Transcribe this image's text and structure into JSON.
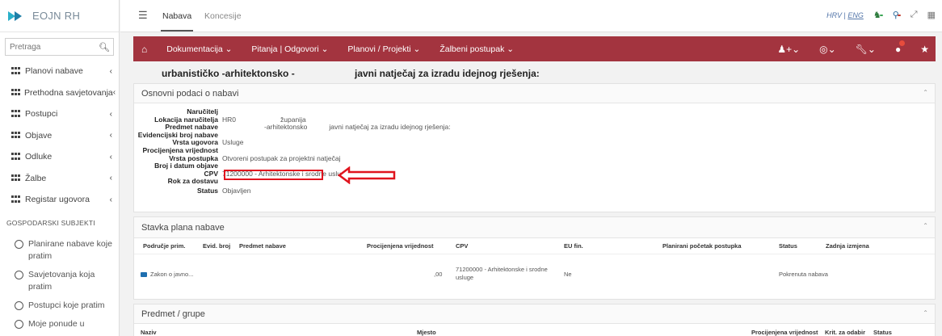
{
  "app": {
    "logo_text": "EOJN RH"
  },
  "search": {
    "placeholder": "Pretraga"
  },
  "sidebar": {
    "items": [
      {
        "label": "Planovi nabave"
      },
      {
        "label": "Prethodna savjetovanja"
      },
      {
        "label": "Postupci"
      },
      {
        "label": "Objave"
      },
      {
        "label": "Odluke"
      },
      {
        "label": "Žalbe"
      },
      {
        "label": "Registar ugovora"
      }
    ],
    "section_label": "GOSPODARSKI SUBJEKTI",
    "follow_items": [
      {
        "label": "Planirane nabave koje pratim"
      },
      {
        "label": "Savjetovanja koja pratim"
      },
      {
        "label": "Postupci koje pratim"
      },
      {
        "label": "Moje ponude u"
      }
    ]
  },
  "topbar": {
    "tabs": [
      {
        "label": "Nabava"
      },
      {
        "label": "Koncesije"
      }
    ],
    "lang_hr": "HRV",
    "lang_sep": "|",
    "lang_en": "ENG"
  },
  "menubar": {
    "items": [
      {
        "label": "Dokumentacija ⌄"
      },
      {
        "label": "Pitanja | Odgovori ⌄"
      },
      {
        "label": "Planovi / Projekti ⌄"
      },
      {
        "label": "Žalbeni postupak ⌄"
      }
    ]
  },
  "title": {
    "part1": "urbanističko -arhitektonsko -",
    "part2": "javni natječaj za izradu idejnog rješenja:"
  },
  "osnovni": {
    "heading": "Osnovni podaci o nabavi",
    "rows": [
      {
        "label": "Naručitelj",
        "value": ""
      },
      {
        "label": "Lokacija naručitelja",
        "value": "HR0",
        "extra": "županija"
      },
      {
        "label": "Predmet nabave",
        "value": "-arhitektonsko",
        "extra": "javni natječaj za izradu idejnog rješenja:"
      },
      {
        "label": "Evidencijski broj nabave",
        "value": ""
      },
      {
        "label": "Vrsta ugovora",
        "value": "Usluge"
      },
      {
        "label": "Procijenjena vrijednost",
        "value": ""
      },
      {
        "label": "Vrsta postupka",
        "value": "Otvoreni postupak za projektni natječaj"
      },
      {
        "label": "Broj i datum objave",
        "value": ""
      },
      {
        "label": "CPV",
        "value": "71200000 - Arhitektonske i srodne usluge"
      },
      {
        "label": "Rok za dostavu",
        "value": ""
      },
      {
        "label": "Status",
        "value": "Objavljen"
      }
    ]
  },
  "stavka": {
    "heading": "Stavka plana nabave",
    "columns": [
      "Područje prim.",
      "Evid. broj",
      "Predmet nabave",
      "Procijenjena vrijednost",
      "CPV",
      "EU fin.",
      "Planirani početak postupka",
      "Status",
      "Zadnja izmjena"
    ],
    "row": {
      "podrucje": "Zakon o javno...",
      "vrijednost": ",00",
      "cpv_line1": "71200000 - Arhitektonske i srodne",
      "cpv_line2": "usluge",
      "eu_fin": "Ne",
      "status": "Pokrenuta nabava"
    }
  },
  "predmet": {
    "heading": "Predmet / grupe",
    "columns": [
      "Naziv",
      "Mjesto",
      "Procijenjena vrijednost",
      "Krit. za odabir",
      "Status"
    ]
  }
}
